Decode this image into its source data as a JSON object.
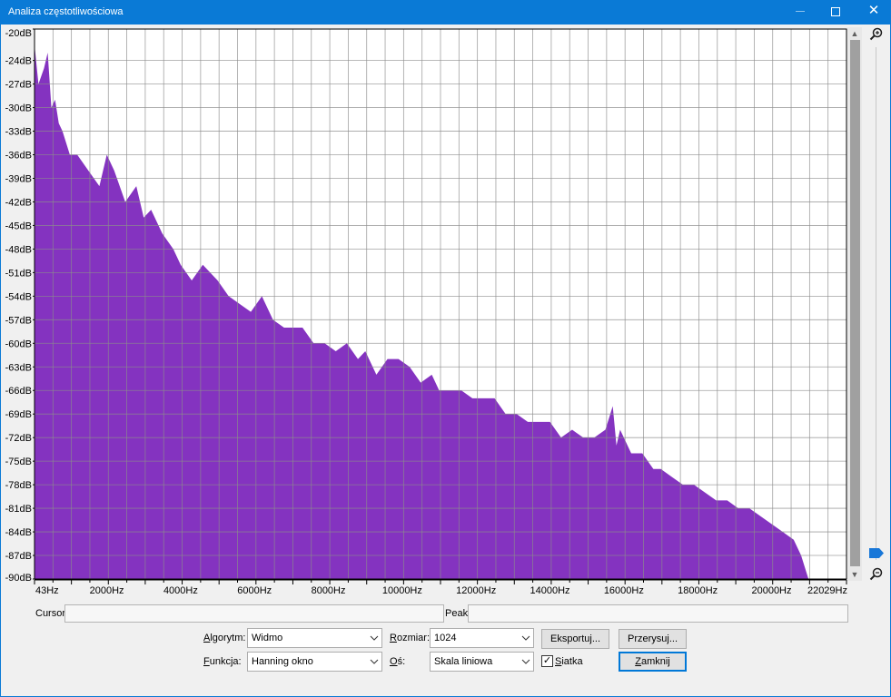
{
  "window": {
    "title": "Analiza częstotliwościowa",
    "close_glyph": "✕"
  },
  "chart_data": {
    "type": "area",
    "title": "",
    "xlabel": "",
    "ylabel": "",
    "y_unit": "dB",
    "x_unit": "Hz",
    "xlim": [
      43,
      22029
    ],
    "ylim": [
      -90,
      -20
    ],
    "grid": true,
    "fill_color": "#8433c0",
    "y_ticks": [
      "-20dB",
      "-24dB",
      "-27dB",
      "-30dB",
      "-33dB",
      "-36dB",
      "-39dB",
      "-42dB",
      "-45dB",
      "-48dB",
      "-51dB",
      "-54dB",
      "-57dB",
      "-60dB",
      "-63dB",
      "-66dB",
      "-69dB",
      "-72dB",
      "-75dB",
      "-78dB",
      "-81dB",
      "-84dB",
      "-87dB",
      "-90dB"
    ],
    "y_tick_values": [
      -20,
      -24,
      -27,
      -30,
      -33,
      -36,
      -39,
      -42,
      -45,
      -48,
      -51,
      -54,
      -57,
      -60,
      -63,
      -66,
      -69,
      -72,
      -75,
      -78,
      -81,
      -84,
      -87,
      -90
    ],
    "x_ticks": [
      "43Hz",
      "2000Hz",
      "4000Hz",
      "6000Hz",
      "8000Hz",
      "10000Hz",
      "12000Hz",
      "14000Hz",
      "16000Hz",
      "18000Hz",
      "20000Hz",
      "22029Hz"
    ],
    "x_tick_values": [
      43,
      2000,
      4000,
      6000,
      8000,
      10000,
      12000,
      14000,
      16000,
      18000,
      20000,
      22029
    ],
    "series": [
      {
        "x": [
          43,
          150,
          300,
          400,
          500,
          600,
          700,
          800,
          1000,
          1200,
          1500,
          1800,
          2000,
          2200,
          2500,
          2800,
          3000,
          3200,
          3500,
          3800,
          4000,
          4300,
          4600,
          5000,
          5300,
          5600,
          5900,
          6200,
          6500,
          6800,
          7000,
          7300,
          7600,
          7900,
          8200,
          8500,
          8800,
          9000,
          9300,
          9600,
          9900,
          10200,
          10500,
          10800,
          11000,
          11300,
          11600,
          11900,
          12200,
          12500,
          12800,
          13100,
          13400,
          13700,
          14000,
          14300,
          14600,
          14900,
          15200,
          15500,
          15700,
          15800,
          15900,
          16200,
          16500,
          16800,
          17000,
          17300,
          17600,
          17900,
          18200,
          18500,
          18800,
          19100,
          19400,
          19700,
          20000,
          20300,
          20600,
          20800,
          21000,
          21200,
          21300
        ],
        "y": [
          -22,
          -27,
          -25,
          -23,
          -30,
          -29,
          -32,
          -33,
          -36,
          -36,
          -38,
          -40,
          -36,
          -38,
          -42,
          -40,
          -44,
          -43,
          -46,
          -48,
          -50,
          -52,
          -50,
          -52,
          -54,
          -55,
          -56,
          -54,
          -57,
          -58,
          -58,
          -58,
          -60,
          -60,
          -61,
          -60,
          -62,
          -61,
          -64,
          -62,
          -62,
          -63,
          -65,
          -64,
          -66,
          -66,
          -66,
          -67,
          -67,
          -67,
          -69,
          -69,
          -70,
          -70,
          -70,
          -72,
          -71,
          -72,
          -72,
          -71,
          -68,
          -73,
          -71,
          -74,
          -74,
          -76,
          -76,
          -77,
          -78,
          -78,
          -79,
          -80,
          -80,
          -81,
          -81,
          -82,
          -83,
          -84,
          -85,
          -87,
          -90,
          -90,
          -90
        ]
      }
    ]
  },
  "cursor": {
    "label": "Cursor:",
    "value": ""
  },
  "peak": {
    "label": "Peak:",
    "value": ""
  },
  "controls": {
    "algorithm": {
      "label": "Algorytm:",
      "value": "Widmo"
    },
    "function": {
      "label": "Funkcja:",
      "value": "Hanning okno"
    },
    "size": {
      "label": "Rozmiar:",
      "value": "1024"
    },
    "axis": {
      "label": "Oś:",
      "value": "Skala liniowa"
    },
    "grid_checkbox": {
      "label": "Siatka",
      "checked": true,
      "mark": "✓"
    },
    "export_button": "Eksportuj...",
    "redraw_button": "Przerysuj...",
    "close_button": "Zamknij"
  }
}
